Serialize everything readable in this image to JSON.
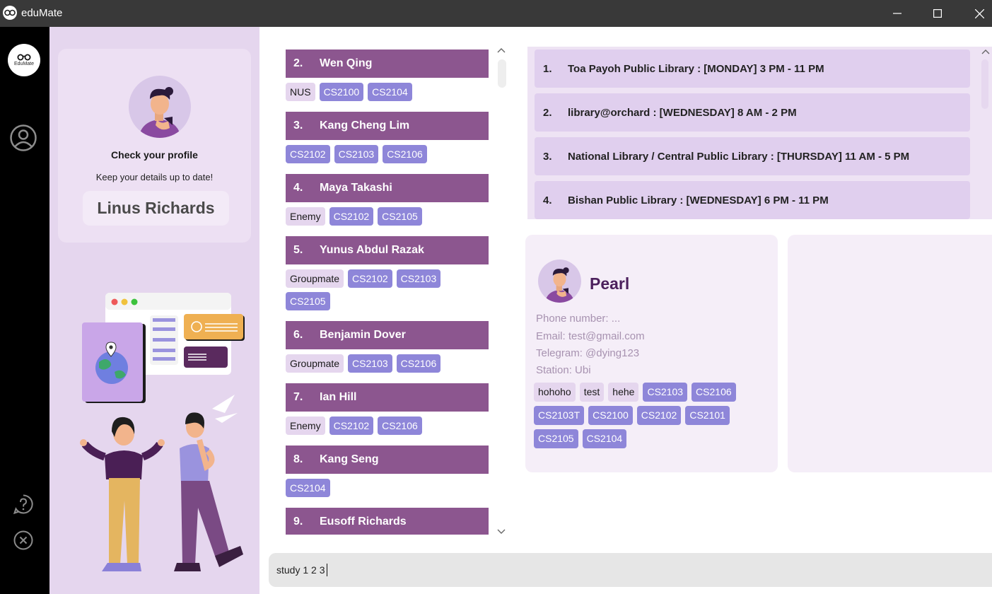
{
  "window": {
    "title": "eduMate",
    "minimize_icon": "minimize-icon",
    "maximize_icon": "maximize-icon",
    "close_icon": "close-icon"
  },
  "sidebar": {
    "logo_text": "EduMate",
    "icons": [
      "profile-icon",
      "help-icon",
      "exit-icon"
    ]
  },
  "profile": {
    "title": "Check your profile",
    "subtitle": "Keep your details up to date!",
    "name": "Linus Richards"
  },
  "contacts": [
    {
      "index": "2.",
      "name": "Wen Qing",
      "tags": [
        {
          "label": "NUS",
          "kind": "plain"
        },
        {
          "label": "CS2100",
          "kind": "mod"
        },
        {
          "label": "CS2104",
          "kind": "mod"
        }
      ]
    },
    {
      "index": "3.",
      "name": "Kang Cheng Lim",
      "tags": [
        {
          "label": "CS2102",
          "kind": "mod"
        },
        {
          "label": "CS2103",
          "kind": "mod"
        },
        {
          "label": "CS2106",
          "kind": "mod"
        }
      ]
    },
    {
      "index": "4.",
      "name": "Maya Takashi",
      "tags": [
        {
          "label": "Enemy",
          "kind": "plain"
        },
        {
          "label": "CS2102",
          "kind": "mod"
        },
        {
          "label": "CS2105",
          "kind": "mod"
        }
      ]
    },
    {
      "index": "5.",
      "name": "Yunus Abdul Razak",
      "tags": [
        {
          "label": "Groupmate",
          "kind": "plain"
        },
        {
          "label": "CS2102",
          "kind": "mod"
        },
        {
          "label": "CS2103",
          "kind": "mod"
        },
        {
          "label": "CS2105",
          "kind": "mod"
        }
      ]
    },
    {
      "index": "6.",
      "name": "Benjamin Dover",
      "tags": [
        {
          "label": "Groupmate",
          "kind": "plain"
        },
        {
          "label": "CS2103",
          "kind": "mod"
        },
        {
          "label": "CS2106",
          "kind": "mod"
        }
      ]
    },
    {
      "index": "7.",
      "name": "Ian Hill",
      "tags": [
        {
          "label": "Enemy",
          "kind": "plain"
        },
        {
          "label": "CS2102",
          "kind": "mod"
        },
        {
          "label": "CS2106",
          "kind": "mod"
        }
      ]
    },
    {
      "index": "8.",
      "name": "Kang Seng",
      "tags": [
        {
          "label": "CS2104",
          "kind": "mod"
        }
      ]
    },
    {
      "index": "9.",
      "name": "Eusoff Richards",
      "tags": []
    }
  ],
  "study_spots": [
    {
      "index": "1.",
      "text": "Toa Payoh Public Library : [MONDAY] 3 PM - 11 PM"
    },
    {
      "index": "2.",
      "text": "library@orchard : [WEDNESDAY] 8 AM - 2 PM"
    },
    {
      "index": "3.",
      "text": "National Library / Central Public Library : [THURSDAY] 11 AM - 5 PM"
    },
    {
      "index": "4.",
      "text": "Bishan Public Library : [WEDNESDAY] 6 PM - 11 PM"
    }
  ],
  "person_card": {
    "name": "Pearl",
    "phone": "Phone number: ...",
    "email": "Email: test@gmail.com",
    "telegram": "Telegram: @dying123",
    "station": "Station: Ubi",
    "tags": [
      {
        "label": "hohoho",
        "kind": "plain"
      },
      {
        "label": "test",
        "kind": "plain"
      },
      {
        "label": "hehe",
        "kind": "plain"
      },
      {
        "label": "CS2103",
        "kind": "mod"
      },
      {
        "label": "CS2106",
        "kind": "mod"
      },
      {
        "label": "CS2103T",
        "kind": "mod"
      },
      {
        "label": "CS2100",
        "kind": "mod"
      },
      {
        "label": "CS2102",
        "kind": "mod"
      },
      {
        "label": "CS2101",
        "kind": "mod"
      },
      {
        "label": "CS2105",
        "kind": "mod"
      },
      {
        "label": "CS2104",
        "kind": "mod"
      }
    ]
  },
  "command_box": {
    "value": "study 1 2 3"
  },
  "colors": {
    "accent": "#8c568f",
    "module_tag": "#8e86d9",
    "plain_tag": "#e5d6ee",
    "panel_bg": "#e5d6ee"
  }
}
